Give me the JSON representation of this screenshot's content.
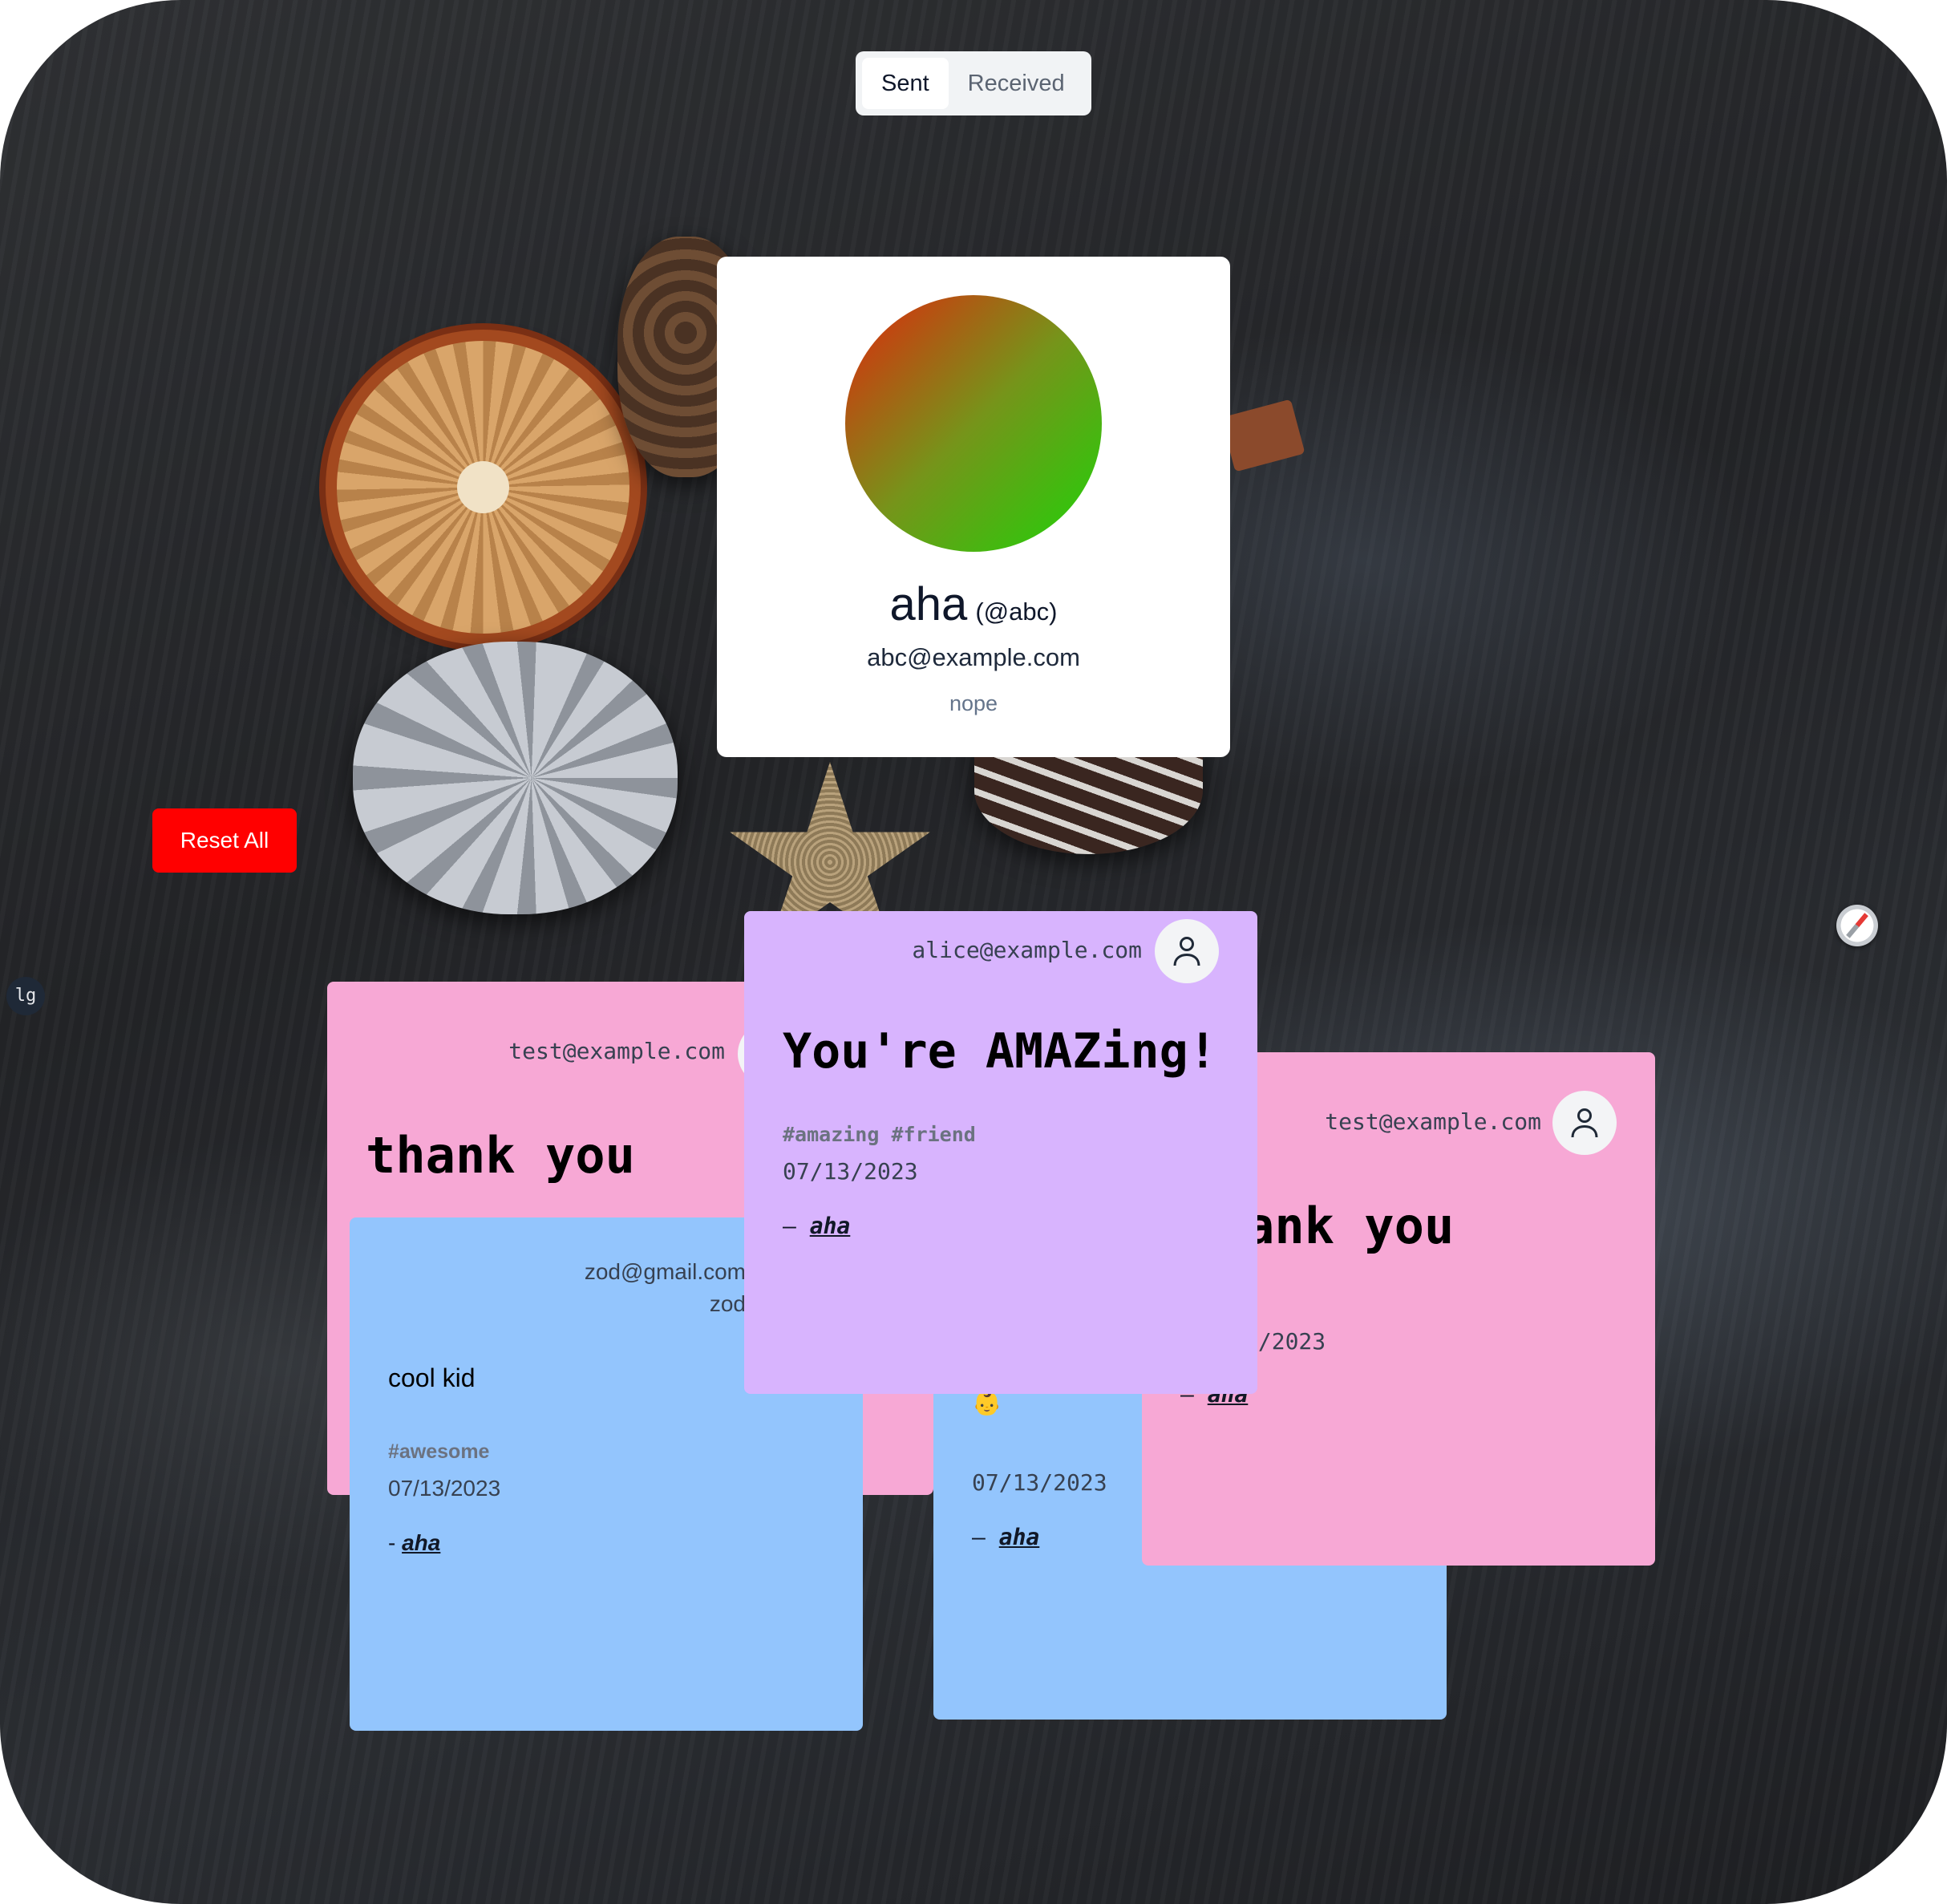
{
  "tabs": [
    {
      "label": "Sent",
      "active": true
    },
    {
      "label": "Received",
      "active": false
    }
  ],
  "profile": {
    "name": "aha",
    "handle": "(@abc)",
    "email": "abc@example.com",
    "bio": "nope",
    "avatar_gradient": [
      "#e0260d",
      "#1fd309"
    ]
  },
  "reset_button": {
    "label": "Reset All",
    "color": "#ff0000"
  },
  "breakpoint_badge": "lg",
  "notes": [
    {
      "id": "note-1",
      "color": "#f7a8d5",
      "from": "test@example.com",
      "message": "thank you"
    },
    {
      "id": "note-2",
      "color": "#93c5fd",
      "from": "zod@gmail.com",
      "from_name": "zod",
      "message": "cool kid",
      "tags": "#awesome",
      "date": "07/13/2023",
      "dash": "-",
      "author": "aha"
    },
    {
      "id": "note-3",
      "color": "#93c5fd",
      "emoji": "👶",
      "date": "07/13/2023",
      "dash": "–",
      "author": "aha"
    },
    {
      "id": "note-4",
      "color": "#f7a8d5",
      "from": "test@example.com",
      "message": "ank you",
      "date": "7/2023",
      "dash": "–",
      "author": "aha"
    },
    {
      "id": "note-5",
      "color": "#d8b4fe",
      "from": "alice@example.com",
      "message": "You're AMAZing!",
      "tags": "#amazing #friend",
      "date": "07/13/2023",
      "dash": "–",
      "author": "aha"
    }
  ]
}
